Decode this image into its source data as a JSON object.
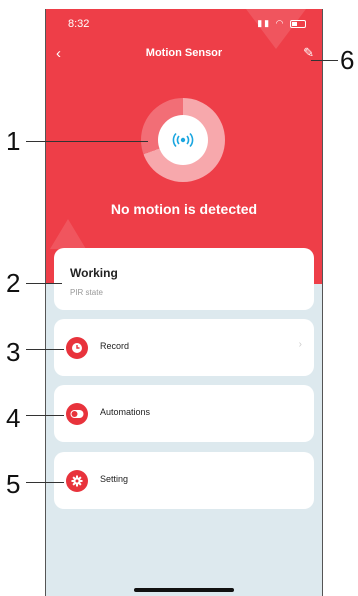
{
  "status_bar": {
    "time": "8:32"
  },
  "header": {
    "title": "Motion Sensor"
  },
  "hero": {
    "status_text": "No motion is detected"
  },
  "pir_card": {
    "value": "Working",
    "label": "PIR state"
  },
  "menu": {
    "record": "Record",
    "automations": "Automations",
    "setting": "Setting"
  },
  "callouts": [
    "1",
    "2",
    "3",
    "4",
    "5",
    "6"
  ],
  "colors": {
    "accent": "#ee3e48",
    "background": "#dde9ee",
    "icon_blue": "#1aa6e0"
  }
}
